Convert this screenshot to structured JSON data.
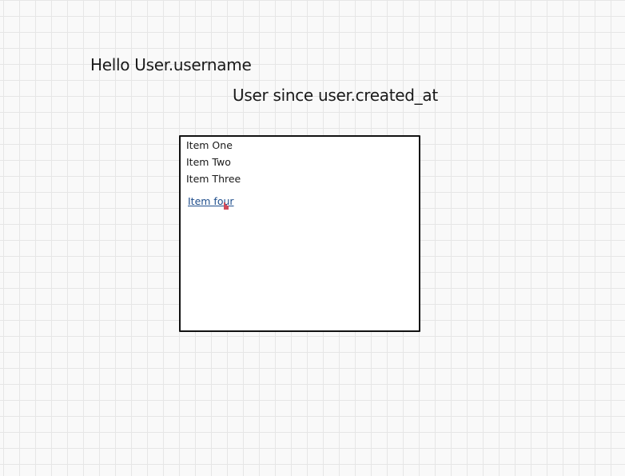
{
  "header": {
    "greeting": "Hello User.username",
    "since": "User since user.created_at"
  },
  "list": {
    "items": [
      {
        "label": "Item One"
      },
      {
        "label": "Item Two"
      },
      {
        "label": "Item Three"
      }
    ],
    "link": {
      "label": "Item four"
    }
  },
  "colors": {
    "link": "#1f4e8c",
    "cursor": "#d04a5a"
  },
  "icons": {
    "cursor": "hand-pointer-icon"
  }
}
